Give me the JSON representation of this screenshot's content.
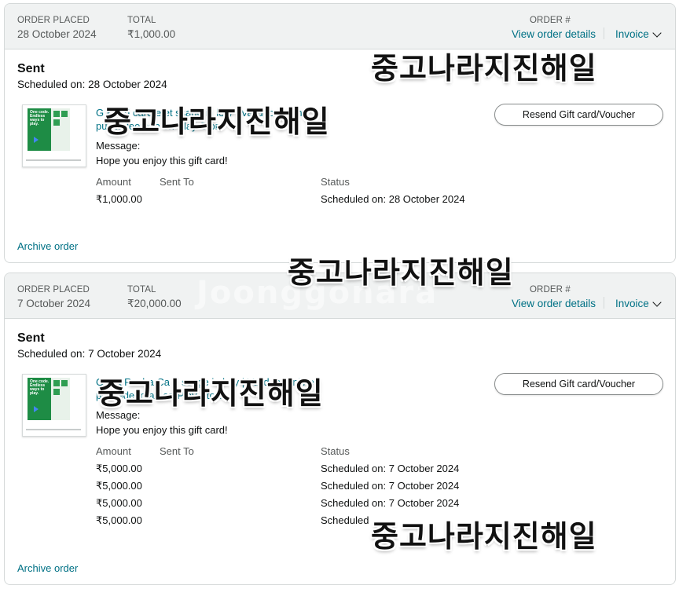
{
  "orders": [
    {
      "header": {
        "placed_label": "ORDER PLACED",
        "placed_value": "28 October 2024",
        "total_label": "TOTAL",
        "total_value": "₹1,000.00",
        "order_label": "ORDER #",
        "details_link": "View order details",
        "invoice_link": "Invoice"
      },
      "shipment": {
        "title": "Sent",
        "scheduled": "Scheduled on: 28 October 2024",
        "product_line1": "G   Pla   d card   e     et  ssage in   lery | Valid for online",
        "product_line2": "pu        Redeemab  on Play Store",
        "message_label": "Message:",
        "message_text": "Hope you enjoy this gift card!",
        "resend_label": "Resend Gift card/Voucher",
        "col_amount": "Amount",
        "col_sentto": "Sent To",
        "col_status": "Status",
        "rows": [
          {
            "amount": "₹1,000.00",
            "status": "Scheduled on: 28 October 2024"
          }
        ],
        "archive": "Archive order"
      }
    },
    {
      "header": {
        "placed_label": "ORDER PLACED",
        "placed_value": "7 October 2024",
        "total_label": "TOTAL",
        "total_value": "₹20,000.00",
        "order_label": "ORDER #",
        "details_link": "View order details",
        "invoice_link": "Invoice"
      },
      "shipment": {
        "title": "Sent",
        "scheduled": "Scheduled on: 7 October 2024",
        "product_line1": "G   Pla   Recha   Ca    F  ssage in   lery | Valid for online",
        "product_line2": "pu        Redeemab  on Play Store",
        "message_label": "Message:",
        "message_text": "Hope you enjoy this gift card!",
        "resend_label": "Resend Gift card/Voucher",
        "col_amount": "Amount",
        "col_sentto": "Sent To",
        "col_status": "Status",
        "rows": [
          {
            "amount": "₹5,000.00",
            "status": "Scheduled on: 7 October 2024"
          },
          {
            "amount": "₹5,000.00",
            "status": "Scheduled on: 7 October 2024"
          },
          {
            "amount": "₹5,000.00",
            "status": "Scheduled on: 7 October 2024"
          },
          {
            "amount": "₹5,000.00",
            "status": "Scheduled"
          }
        ],
        "archive": "Archive order"
      }
    }
  ],
  "overlays": [
    "중고나라지진해일",
    "중고나라지진해일",
    "중고나라지진해일",
    "중고나라지진해일",
    "중고나라지진해일"
  ],
  "watermark": "Joonggonara",
  "thumb_text": "One code. Endless ways to play.",
  "colors": {
    "link": "#007185",
    "header_bg": "#f0f2f2",
    "border": "#d5d9d9",
    "gift_green": "#1e8c45"
  }
}
